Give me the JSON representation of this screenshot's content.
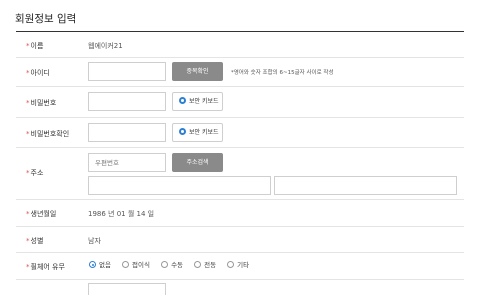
{
  "page": {
    "title": "회원정보 입력"
  },
  "fields": {
    "name": {
      "label": "이름",
      "value": "웹에이커21"
    },
    "user_id": {
      "label": "아이디",
      "value": "",
      "check_button": "중복확인",
      "hint": "*영어와 숫자 조합의 6~15글자 사이로 작성"
    },
    "password": {
      "label": "비밀번호",
      "value": "",
      "keyboard_button": "보안 키보드"
    },
    "password_confirm": {
      "label": "비밀번호확인",
      "value": "",
      "keyboard_button": "보안 키보드"
    },
    "address": {
      "label": "주소",
      "postcode_placeholder": "우편번호",
      "search_button": "주소검색",
      "address1": "",
      "address2": ""
    },
    "birth": {
      "label": "생년월일",
      "value": "1986 년 01 월 14 일"
    },
    "gender": {
      "label": "성별",
      "value": "남자"
    },
    "wheelchair": {
      "label": "휠체어 유무",
      "selected": "없음",
      "options": [
        "없음",
        "접이식",
        "수동",
        "전동",
        "기타"
      ]
    }
  },
  "colors": {
    "required": "#d9534f",
    "accent": "#2d7fd3",
    "button_gray": "#8a8a8a"
  }
}
